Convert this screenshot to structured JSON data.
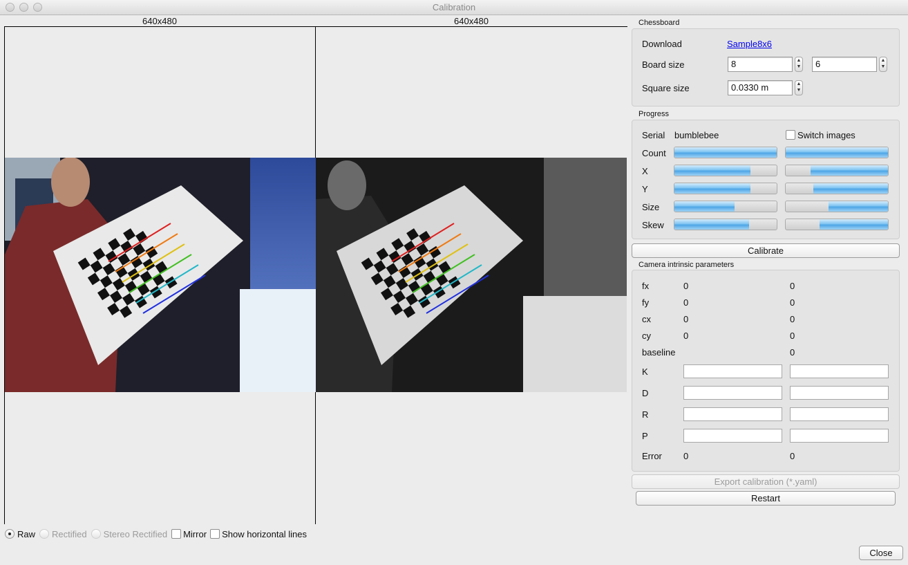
{
  "window": {
    "title": "Calibration"
  },
  "views": {
    "left_label": "640x480",
    "right_label": "640x480"
  },
  "bottom": {
    "raw": "Raw",
    "rectified": "Rectified",
    "stereo_rectified": "Stereo Rectified",
    "mirror": "Mirror",
    "horizontal_lines": "Show horizontal lines"
  },
  "chessboard": {
    "title": "Chessboard",
    "download_label": "Download",
    "download_link": "Sample8x6",
    "board_size_label": "Board size",
    "board_w": "8",
    "board_h": "6",
    "square_size_label": "Square size",
    "square_size": "0.0330 m"
  },
  "progress": {
    "title": "Progress",
    "serial_label": "Serial",
    "serial_value": "bumblebee",
    "switch_images": "Switch images",
    "rows": [
      {
        "label": "Count",
        "left": 1.0,
        "right": 1.0
      },
      {
        "label": "X",
        "left": 0.74,
        "right": 0.76
      },
      {
        "label": "Y",
        "left": 0.74,
        "right": 0.73
      },
      {
        "label": "Size",
        "left": 0.59,
        "right": 0.58
      },
      {
        "label": "Skew",
        "left": 0.73,
        "right": 0.67
      }
    ]
  },
  "calibrate_button": "Calibrate",
  "intrinsics": {
    "title": "Camera intrinsic parameters",
    "fx": "fx",
    "fx_l": "0",
    "fx_r": "0",
    "fy": "fy",
    "fy_l": "0",
    "fy_r": "0",
    "cx": "cx",
    "cx_l": "0",
    "cx_r": "0",
    "cy": "cy",
    "cy_l": "0",
    "cy_r": "0",
    "baseline": "baseline",
    "baseline_r": "0",
    "k": "K",
    "d": "D",
    "r": "R",
    "p": "P",
    "error": "Error",
    "error_l": "0",
    "error_r": "0"
  },
  "export_button": "Export calibration (*.yaml)",
  "restart_button": "Restart",
  "close_button": "Close",
  "colors": {
    "progress_fill": "#5aaeea",
    "link": "#0000ee"
  }
}
